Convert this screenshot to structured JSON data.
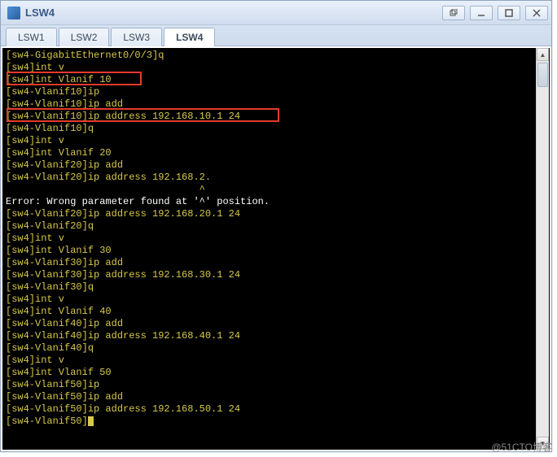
{
  "window": {
    "title": "LSW4"
  },
  "tabs": [
    {
      "label": "LSW1",
      "active": false
    },
    {
      "label": "LSW2",
      "active": false
    },
    {
      "label": "LSW3",
      "active": false
    },
    {
      "label": "LSW4",
      "active": true
    }
  ],
  "terminal": {
    "lines": [
      {
        "t": "[sw4-GigabitEthernet0/0/3]q",
        "cls": ""
      },
      {
        "t": "[sw4]int v",
        "cls": ""
      },
      {
        "t": "[sw4]int Vlanif 10",
        "cls": ""
      },
      {
        "t": "[sw4-Vlanif10]ip",
        "cls": ""
      },
      {
        "t": "[sw4-Vlanif10]ip add",
        "cls": ""
      },
      {
        "t": "[sw4-Vlanif10]ip address 192.168.10.1 24",
        "cls": ""
      },
      {
        "t": "[sw4-Vlanif10]q",
        "cls": ""
      },
      {
        "t": "[sw4]int v",
        "cls": ""
      },
      {
        "t": "[sw4]int Vlanif 20",
        "cls": ""
      },
      {
        "t": "[sw4-Vlanif20]ip add",
        "cls": ""
      },
      {
        "t": "[sw4-Vlanif20]ip address 192.168.2.",
        "cls": ""
      },
      {
        "t": "                                 ^",
        "cls": ""
      },
      {
        "t": "Error: Wrong parameter found at '^' position.",
        "cls": "err"
      },
      {
        "t": "[sw4-Vlanif20]ip address 192.168.20.1 24",
        "cls": ""
      },
      {
        "t": "[sw4-Vlanif20]q",
        "cls": ""
      },
      {
        "t": "[sw4]int v",
        "cls": ""
      },
      {
        "t": "[sw4]int Vlanif 30",
        "cls": ""
      },
      {
        "t": "[sw4-Vlanif30]ip add",
        "cls": ""
      },
      {
        "t": "[sw4-Vlanif30]ip address 192.168.30.1 24",
        "cls": ""
      },
      {
        "t": "[sw4-Vlanif30]q",
        "cls": ""
      },
      {
        "t": "[sw4]int v",
        "cls": ""
      },
      {
        "t": "[sw4]int Vlanif 40",
        "cls": ""
      },
      {
        "t": "[sw4-Vlanif40]ip add",
        "cls": ""
      },
      {
        "t": "[sw4-Vlanif40]ip address 192.168.40.1 24",
        "cls": ""
      },
      {
        "t": "[sw4-Vlanif40]q",
        "cls": ""
      },
      {
        "t": "[sw4]int v",
        "cls": ""
      },
      {
        "t": "[sw4]int Vlanif 50",
        "cls": ""
      },
      {
        "t": "[sw4-Vlanif50]ip",
        "cls": ""
      },
      {
        "t": "[sw4-Vlanif50]ip add",
        "cls": ""
      },
      {
        "t": "[sw4-Vlanif50]ip address 192.168.50.1 24",
        "cls": ""
      },
      {
        "t": "[sw4-Vlanif50]",
        "cls": "",
        "cursor": true
      }
    ]
  },
  "watermark": "@51CTO博客"
}
